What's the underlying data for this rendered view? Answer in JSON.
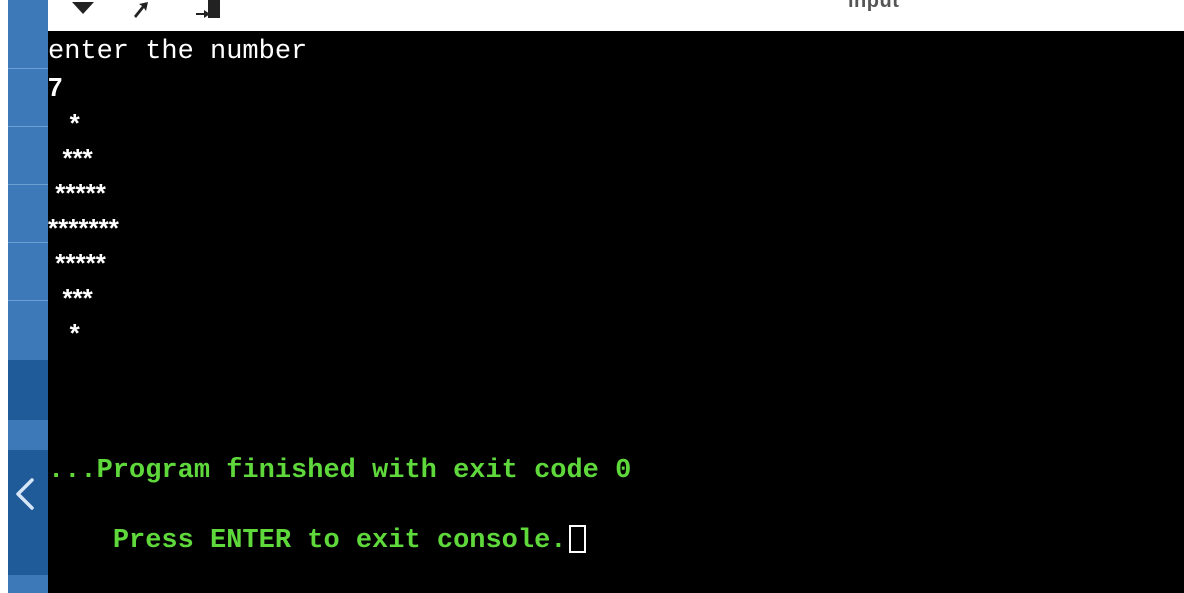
{
  "toolbar": {
    "title": "input",
    "icons": [
      "chevron-down-icon",
      "arrow-icon",
      "step-into-icon"
    ]
  },
  "console": {
    "prompt": "enter the number",
    "input_value": "7",
    "pattern": [
      "   *",
      "  ***",
      " *****",
      "*******",
      " *****",
      "  ***",
      "   *"
    ],
    "finished_message": "...Program finished with exit code 0",
    "exit_prompt": "Press ENTER to exit console."
  },
  "colors": {
    "console_bg": "#000000",
    "console_text": "#ffffff",
    "status_text": "#5fd83c",
    "sidebar_blue": "#3d78b8",
    "sidebar_dark": "#1f5a99"
  }
}
